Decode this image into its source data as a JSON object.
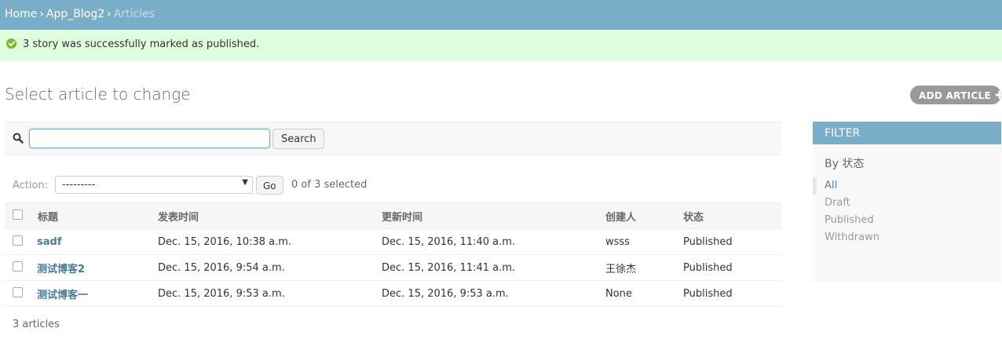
{
  "breadcrumbs": {
    "home": "Home",
    "app": "App_Blog2",
    "current": "Articles",
    "separator": "›"
  },
  "message": {
    "text": "3 story was successfully marked as published."
  },
  "page": {
    "title": "Select article to change",
    "add_button": "ADD ARTICLE"
  },
  "search": {
    "value": "",
    "button": "Search"
  },
  "actions": {
    "label": "Action:",
    "selected_option": "---------",
    "go_button": "Go",
    "selection_count": "0 of 3 selected"
  },
  "table": {
    "headers": [
      "标题",
      "发表时间",
      "更新时间",
      "创建人",
      "状态"
    ],
    "rows": [
      {
        "title": "sadf",
        "published": "Dec. 15, 2016, 10:38 a.m.",
        "updated": "Dec. 15, 2016, 11:40 a.m.",
        "author": "wsss",
        "status": "Published"
      },
      {
        "title": "测试博客2",
        "published": "Dec. 15, 2016, 9:54 a.m.",
        "updated": "Dec. 15, 2016, 11:41 a.m.",
        "author": "王徐杰",
        "status": "Published"
      },
      {
        "title": "测试博客一",
        "published": "Dec. 15, 2016, 9:53 a.m.",
        "updated": "Dec. 15, 2016, 9:53 a.m.",
        "author": "None",
        "status": "Published"
      }
    ]
  },
  "paginator": "3 articles",
  "filter": {
    "header": "FILTER",
    "subtitle": "By 状态",
    "options": [
      "All",
      "Draft",
      "Published",
      "Withdrawn"
    ],
    "selected": "All"
  },
  "colors": {
    "header_blue": "#79aec8",
    "success_green": "#dfd",
    "link_blue": "#447e9b"
  }
}
